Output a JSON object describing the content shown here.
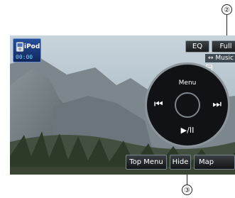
{
  "callouts": {
    "top": "②",
    "bottom": "③"
  },
  "source": {
    "name": "iPod",
    "time": "00:00"
  },
  "top_buttons": [
    {
      "label": "EQ"
    },
    {
      "label": "Full"
    }
  ],
  "music_label": "↔ Music",
  "wheel": {
    "menu": "Menu",
    "prev": "⏮",
    "next": "⏭",
    "play_pause": "▶/II"
  },
  "bottom_buttons": [
    {
      "label": "Top Menu"
    },
    {
      "label": "Hide"
    },
    {
      "label": "Map"
    }
  ]
}
